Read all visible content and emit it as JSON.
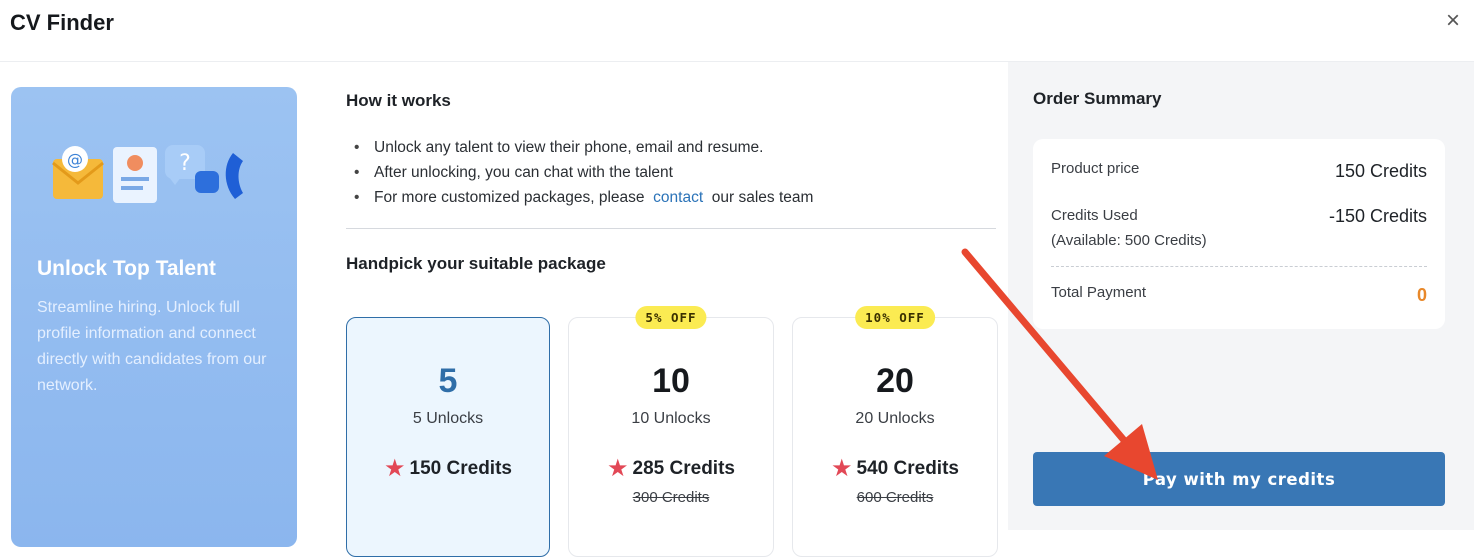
{
  "dialog": {
    "title": "CV Finder",
    "close_label": "×"
  },
  "promo": {
    "heading": "Unlock Top Talent",
    "description": "Streamline hiring. Unlock full profile information and connect directly with candidates from our network."
  },
  "how_it_works": {
    "title": "How it works",
    "bullet_1": "Unlock any talent to view their phone, email and resume.",
    "bullet_2": "After unlocking, you can chat with the talent",
    "bullet_3_prefix": "For more customized packages, please",
    "bullet_3_link": "contact",
    "bullet_3_suffix": "our sales team"
  },
  "packages": {
    "title": "Handpick your suitable package",
    "items": [
      {
        "count": "5",
        "unlocks": "5 Unlocks",
        "credits": "150 Credits",
        "selected": true
      },
      {
        "count": "10",
        "unlocks": "10 Unlocks",
        "credits": "285 Credits",
        "original": "300 Credits",
        "badge": "5% OFF"
      },
      {
        "count": "20",
        "unlocks": "20 Unlocks",
        "credits": "540 Credits",
        "original": "600 Credits",
        "badge": "10% OFF"
      }
    ]
  },
  "order_summary": {
    "title": "Order Summary",
    "product_price_label": "Product price",
    "product_price_value": "150 Credits",
    "credits_used_label": "Credits Used",
    "credits_available": "(Available: 500 Credits)",
    "credits_used_value": "-150 Credits",
    "total_label": "Total Payment",
    "total_value": "0",
    "pay_button": "Pay with my credits"
  },
  "colors": {
    "accent": "#3977b5",
    "promo_bg": "#8bb6ee",
    "star": "#e24856",
    "badge": "#fbeb52",
    "total": "#e8882a",
    "annotation_arrow": "#e8472f"
  },
  "icons": [
    "close-icon",
    "envelope-icon",
    "resume-icon",
    "question-bubble-icon",
    "phone-icon",
    "star-icon"
  ]
}
